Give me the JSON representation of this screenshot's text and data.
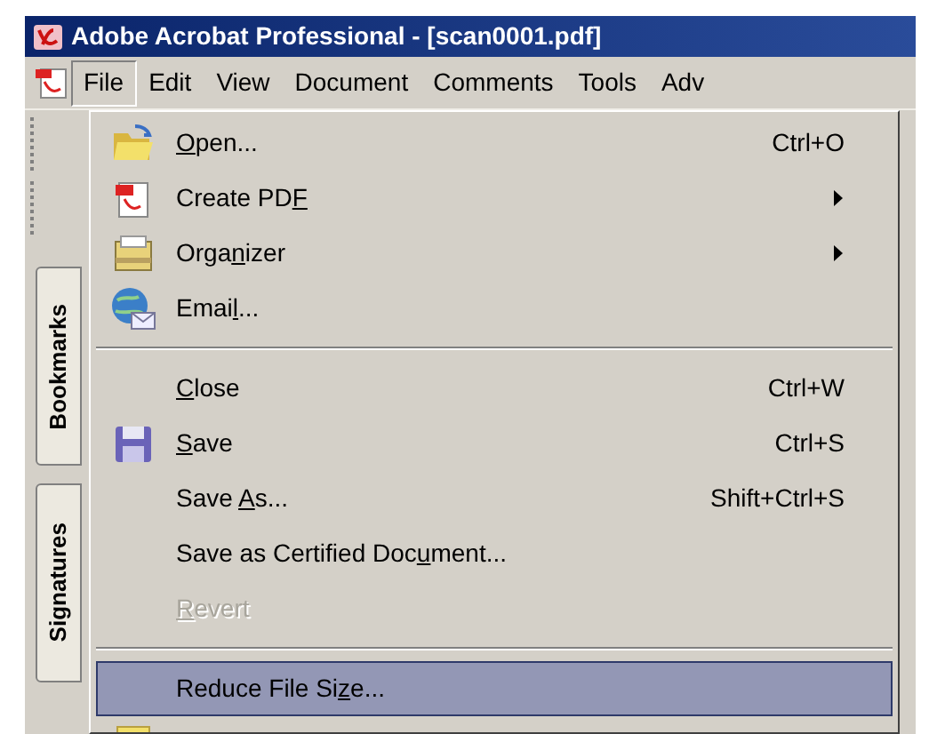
{
  "window": {
    "title": "Adobe Acrobat Professional - [scan0001.pdf]"
  },
  "menu_bar": [
    {
      "label": "File",
      "selected": true
    },
    {
      "label": "Edit",
      "selected": false
    },
    {
      "label": "View",
      "selected": false
    },
    {
      "label": "Document",
      "selected": false
    },
    {
      "label": "Comments",
      "selected": false
    },
    {
      "label": "Tools",
      "selected": false
    },
    {
      "label": "Adv",
      "selected": false
    }
  ],
  "side_tabs": [
    {
      "label": "Bookmarks"
    },
    {
      "label": "Signatures"
    }
  ],
  "file_menu": [
    {
      "kind": "item",
      "label": {
        "key": "O",
        "post": "pen..."
      },
      "shortcut": "Ctrl+O",
      "submenu": false,
      "disabled": false,
      "selected": false
    },
    {
      "kind": "item",
      "label": {
        "pre": "Create PD",
        "key": "F"
      },
      "submenu": true,
      "disabled": false,
      "selected": false
    },
    {
      "kind": "item",
      "label": {
        "pre": "Orga",
        "key": "n",
        "post": "izer"
      },
      "submenu": true,
      "disabled": false,
      "selected": false
    },
    {
      "kind": "item",
      "label": {
        "pre": "Emai",
        "key": "l",
        "post": "..."
      },
      "submenu": false,
      "disabled": false,
      "selected": false
    },
    {
      "kind": "separator"
    },
    {
      "kind": "item",
      "label": {
        "key": "C",
        "post": "lose"
      },
      "shortcut": "Ctrl+W",
      "submenu": false,
      "disabled": false,
      "selected": false
    },
    {
      "kind": "item",
      "label": {
        "key": "S",
        "post": "ave"
      },
      "shortcut": "Ctrl+S",
      "submenu": false,
      "disabled": false,
      "selected": false
    },
    {
      "kind": "item",
      "label": {
        "pre": "Save ",
        "key": "A",
        "post": "s..."
      },
      "shortcut": "Shift+Ctrl+S",
      "submenu": false,
      "disabled": false,
      "selected": false
    },
    {
      "kind": "item",
      "label": {
        "pre": "Save as Certified Doc",
        "key": "u",
        "post": "ment..."
      },
      "submenu": false,
      "disabled": false,
      "selected": false
    },
    {
      "kind": "item",
      "label": {
        "key": "R",
        "post": "evert"
      },
      "submenu": false,
      "disabled": true,
      "selected": false
    },
    {
      "kind": "separator"
    },
    {
      "kind": "item",
      "label": {
        "pre": "Reduce File Si",
        "key": "z",
        "post": "e..."
      },
      "submenu": false,
      "disabled": false,
      "selected": true
    }
  ]
}
